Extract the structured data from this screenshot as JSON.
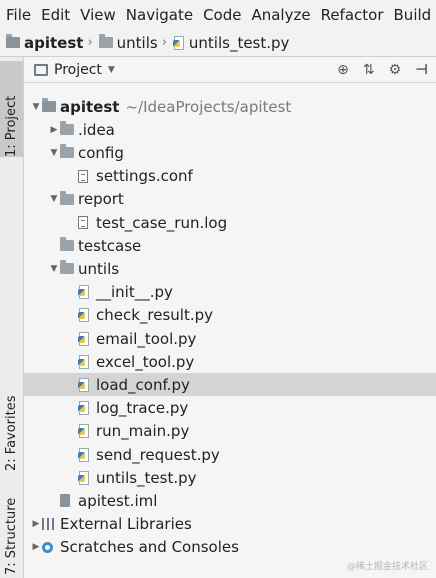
{
  "menubar": {
    "items": [
      "File",
      "Edit",
      "View",
      "Navigate",
      "Code",
      "Analyze",
      "Refactor",
      "Build"
    ],
    "mnemonics": [
      "F",
      "E",
      "V",
      "N",
      "C",
      "z",
      "R",
      "B"
    ]
  },
  "breadcrumb": {
    "items": [
      "apitest",
      "untils",
      "untils_test.py"
    ],
    "icons": [
      "folder-root-icon",
      "folder-icon",
      "python-file-icon"
    ]
  },
  "sidebar": {
    "top_tab": "1: Project",
    "mid_tab": "2: Favorites",
    "bottom_tab": "7: Structure"
  },
  "panel": {
    "title": "Project",
    "tools": [
      "target-icon",
      "collapse-icon",
      "gear-icon",
      "hide-icon"
    ]
  },
  "tree": [
    {
      "label": "apitest",
      "path": "~/IdeaProjects/apitest",
      "level": 0,
      "arrow": "open",
      "icon": "folder-root-icon",
      "bold": true
    },
    {
      "label": ".idea",
      "level": 1,
      "arrow": "closed",
      "icon": "folder-icon"
    },
    {
      "label": "config",
      "level": 1,
      "arrow": "open",
      "icon": "folder-icon"
    },
    {
      "label": "settings.conf",
      "level": 2,
      "arrow": "none",
      "icon": "text-file-icon"
    },
    {
      "label": "report",
      "level": 1,
      "arrow": "open",
      "icon": "folder-icon"
    },
    {
      "label": "test_case_run.log",
      "level": 2,
      "arrow": "none",
      "icon": "text-file-icon"
    },
    {
      "label": "testcase",
      "level": 1,
      "arrow": "none",
      "icon": "folder-icon"
    },
    {
      "label": "untils",
      "level": 1,
      "arrow": "open",
      "icon": "folder-icon"
    },
    {
      "label": "__init__.py",
      "level": 2,
      "arrow": "none",
      "icon": "python-file-icon"
    },
    {
      "label": "check_result.py",
      "level": 2,
      "arrow": "none",
      "icon": "python-file-icon"
    },
    {
      "label": "email_tool.py",
      "level": 2,
      "arrow": "none",
      "icon": "python-file-icon"
    },
    {
      "label": "excel_tool.py",
      "level": 2,
      "arrow": "none",
      "icon": "python-file-icon"
    },
    {
      "label": "load_conf.py",
      "level": 2,
      "arrow": "none",
      "icon": "python-file-icon",
      "selected": true
    },
    {
      "label": "log_trace.py",
      "level": 2,
      "arrow": "none",
      "icon": "python-file-icon"
    },
    {
      "label": "run_main.py",
      "level": 2,
      "arrow": "none",
      "icon": "python-file-icon"
    },
    {
      "label": "send_request.py",
      "level": 2,
      "arrow": "none",
      "icon": "python-file-icon"
    },
    {
      "label": "untils_test.py",
      "level": 2,
      "arrow": "none",
      "icon": "python-file-icon"
    },
    {
      "label": "apitest.iml",
      "level": 1,
      "arrow": "none",
      "icon": "iml-file-icon"
    },
    {
      "label": "External Libraries",
      "level": 0,
      "arrow": "closed",
      "icon": "external-libraries-icon"
    },
    {
      "label": "Scratches and Consoles",
      "level": 0,
      "arrow": "closed",
      "icon": "scratches-icon"
    }
  ],
  "watermark": "@稀土掘金技术社区",
  "colors": {
    "selected_row": "#d4d4d4",
    "background": "#f5f5f5"
  }
}
